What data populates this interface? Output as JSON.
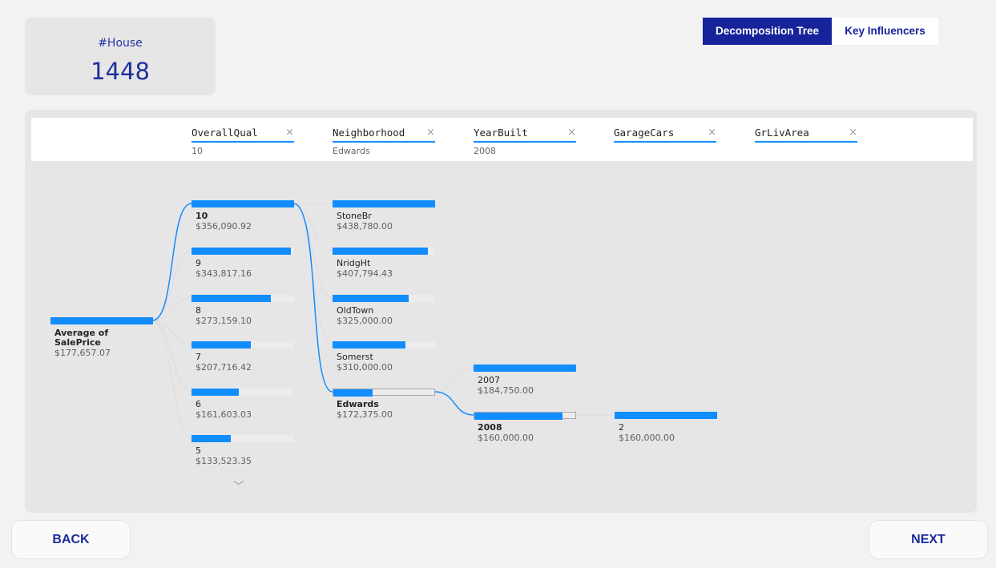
{
  "kpi": {
    "label": "#House",
    "value": "1448"
  },
  "tabs": {
    "active": "Decomposition Tree",
    "inactive": "Key Influencers"
  },
  "levels": [
    {
      "name": "OverallQual",
      "value": "10"
    },
    {
      "name": "Neighborhood",
      "value": "Edwards"
    },
    {
      "name": "YearBuilt",
      "value": "2008"
    },
    {
      "name": "GarageCars",
      "value": ""
    },
    {
      "name": "GrLivArea",
      "value": ""
    }
  ],
  "close_glyph": "×",
  "root": {
    "label": "Average of SalePrice",
    "value": "$177,657.07",
    "fraction": 1.0
  },
  "col1": [
    {
      "label": "10",
      "value": "$356,090.92",
      "fraction": 1.0
    },
    {
      "label": "9",
      "value": "$343,817.16",
      "fraction": 0.97
    },
    {
      "label": "8",
      "value": "$273,159.10",
      "fraction": 0.77
    },
    {
      "label": "7",
      "value": "$207,716.42",
      "fraction": 0.58
    },
    {
      "label": "6",
      "value": "$161,603.03",
      "fraction": 0.46
    },
    {
      "label": "5",
      "value": "$133,523.35",
      "fraction": 0.38
    }
  ],
  "col2": [
    {
      "label": "StoneBr",
      "value": "$438,780.00",
      "fraction": 1.0
    },
    {
      "label": "NridgHt",
      "value": "$407,794.43",
      "fraction": 0.93
    },
    {
      "label": "OldTown",
      "value": "$325,000.00",
      "fraction": 0.74
    },
    {
      "label": "Somerst",
      "value": "$310,000.00",
      "fraction": 0.71
    },
    {
      "label": "Edwards",
      "value": "$172,375.00",
      "fraction": 0.39
    }
  ],
  "col3": [
    {
      "label": "2007",
      "value": "$184,750.00",
      "fraction": 1.0
    },
    {
      "label": "2008",
      "value": "$160,000.00",
      "fraction": 0.87
    }
  ],
  "col4": [
    {
      "label": "2",
      "value": "$160,000.00",
      "fraction": 1.0
    }
  ],
  "expand_glyph": "﹀",
  "nav": {
    "back": "BACK",
    "next": "NEXT"
  },
  "colors": {
    "bar": "#118dff",
    "link": "#118dff",
    "accent": "#16239a"
  }
}
